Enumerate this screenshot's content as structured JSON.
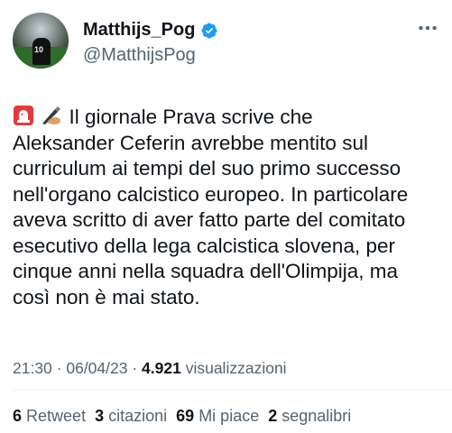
{
  "author": {
    "display_name": "Matthijs_Pog",
    "handle": "@MatthijsPog",
    "verified": true,
    "avatar_number": "10"
  },
  "tweet": {
    "text": "Il giornale Prava scrive che\nAleksander Ceferin avrebbe mentito sul\ncurriculum ai tempi del suo primo successo\nnell'organo calcistico europeo. In particolare\naveva scritto di aver fatto parte del comitato\nesecutivo della lega calcistica slovena, per\ncinque anni nella squadra dell'Olimpija, ma\ncosì non è mai stato.",
    "emojis": [
      "siren-icon",
      "writing-hand-icon"
    ]
  },
  "meta": {
    "time": "21:30",
    "sep1": " · ",
    "date": "06/04/23",
    "sep2": " · ",
    "views_count": "4.921",
    "views_label": " visualizzazioni"
  },
  "stats": [
    {
      "count": "6",
      "label": "Retweet"
    },
    {
      "count": "3",
      "label": "citazioni"
    },
    {
      "count": "69",
      "label": "Mi piace"
    },
    {
      "count": "2",
      "label": "segnalibri"
    }
  ],
  "colors": {
    "text": "#0f1419",
    "secondary": "#536471",
    "verified_blue": "#1d9bf0",
    "divider": "#eff3f4"
  }
}
